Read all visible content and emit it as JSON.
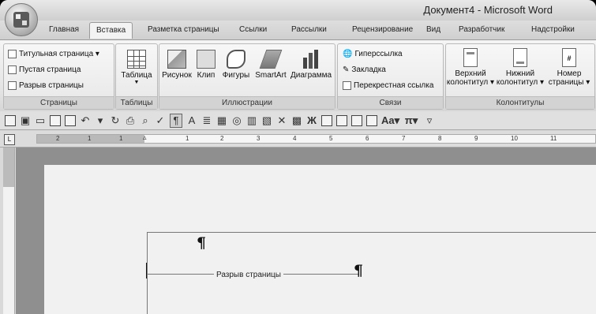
{
  "window": {
    "title": "Документ4 - Microsoft Word"
  },
  "tabs": [
    "Главная",
    "Вставка",
    "Разметка страницы",
    "Ссылки",
    "Рассылки",
    "Рецензирование",
    "Вид",
    "Разработчик",
    "Надстройки"
  ],
  "active_tab": "Вставка",
  "ribbon": {
    "pages": {
      "label": "Страницы",
      "items": [
        "Титульная страница ▾",
        "Пустая страница",
        "Разрыв страницы"
      ]
    },
    "tables": {
      "label": "Таблицы",
      "button": "Таблица"
    },
    "illustrations": {
      "label": "Иллюстрации",
      "buttons": [
        "Рисунок",
        "Клип",
        "Фигуры",
        "SmartArt",
        "Диаграмма"
      ]
    },
    "links": {
      "label": "Связи",
      "items": [
        "Гиперссылка",
        "Закладка",
        "Перекрестная ссылка"
      ]
    },
    "header_footer": {
      "label": "Колонтитулы",
      "buttons": [
        {
          "line1": "Верхний",
          "line2": "колонтитул ▾"
        },
        {
          "line1": "Нижний",
          "line2": "колонтитул ▾"
        },
        {
          "line1": "Номер",
          "line2": "страницы ▾"
        }
      ]
    }
  },
  "ruler": {
    "numbers": [
      "2",
      "1",
      "1",
      "1",
      "2",
      "3",
      "4",
      "5",
      "6",
      "7",
      "8",
      "9",
      "10",
      "11"
    ]
  },
  "document": {
    "page_break_label": "Разрыв страницы",
    "pilcrow": "¶"
  }
}
